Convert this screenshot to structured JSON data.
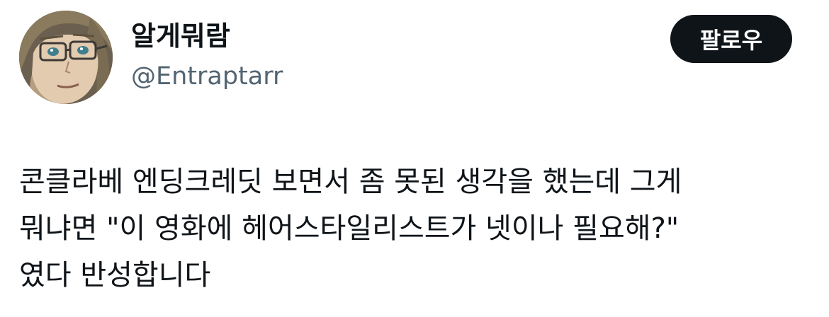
{
  "author": {
    "display_name": "알게뭐람",
    "handle": "@Entraptarr",
    "avatar_icon": "profile-avatar"
  },
  "actions": {
    "follow_label": "팔로우"
  },
  "tweet": {
    "lines": [
      "콘클라베 엔딩크레딧 보면서 좀 못된 생각을 했는데 그게",
      "뭐냐면 \"이 영화에 헤어스타일리스트가 넷이나 필요해?\"",
      "였다 반성합니다"
    ]
  },
  "colors": {
    "text_primary": "#0f1419",
    "text_secondary": "#536471",
    "button_bg": "#0f1419",
    "button_text": "#ffffff",
    "background": "#ffffff"
  }
}
